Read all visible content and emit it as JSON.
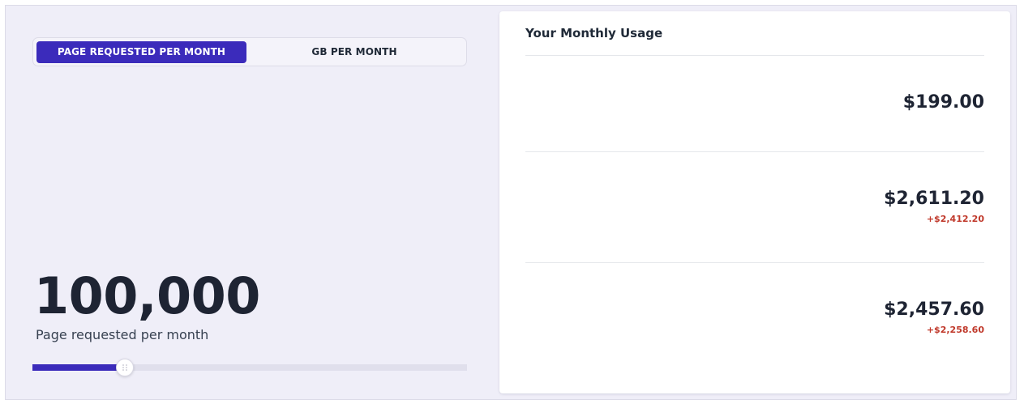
{
  "toggle": {
    "active_label": "PAGE REQUESTED PER MONTH",
    "inactive_label": "GB PER MONTH"
  },
  "metric": {
    "value": "100,000",
    "caption": "Page requested per month"
  },
  "slider": {
    "fill_percent": 21.3
  },
  "usage": {
    "title": "Your Monthly Usage",
    "rows": [
      {
        "price": "$199.00",
        "delta": ""
      },
      {
        "price": "$2,611.20",
        "delta": "+$2,412.20"
      },
      {
        "price": "$2,457.60",
        "delta": "+$2,258.60"
      }
    ]
  },
  "colors": {
    "accent": "#3b2bbb",
    "delta": "#c0392b",
    "panel_bg": "#efeef8"
  }
}
